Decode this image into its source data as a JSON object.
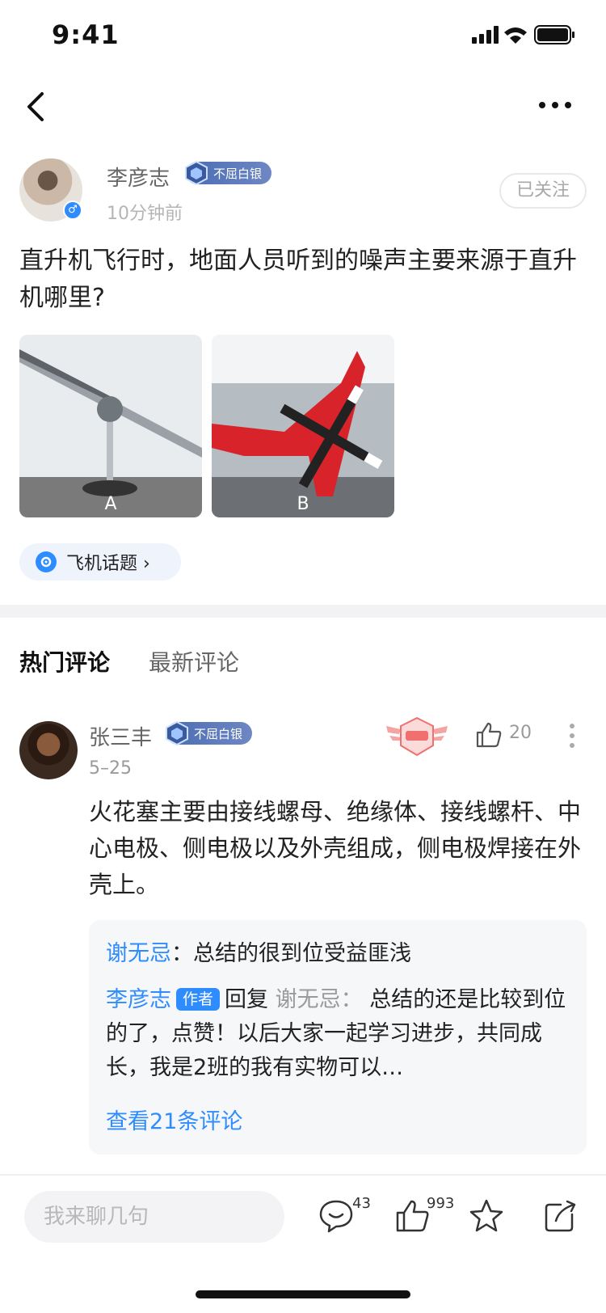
{
  "status_bar": {
    "time": "9:41"
  },
  "post": {
    "author": "李彦志",
    "badge": "不屈白银",
    "time_ago": "10分钟前",
    "follow_label": "已关注",
    "question": "直升机飞行时，地面人员听到的噪声主要来源于直升机哪里?",
    "images": [
      {
        "label": "A"
      },
      {
        "label": "B"
      }
    ],
    "topic": "飞机话题 ›"
  },
  "tabs": {
    "hot": "热门评论",
    "latest": "最新评论"
  },
  "comment": {
    "author": "张三丰",
    "badge": "不屈白银",
    "date": "5–25",
    "likes": "20",
    "text": "火花塞主要由接线螺母、绝缘体、接线螺杆、中心电极、侧电极以及外壳组成，侧电极焊接在外壳上。",
    "replies": {
      "r1_name": "谢无忌",
      "r1_sep": "：",
      "r1_text": "总结的很到位受益匪浅",
      "r2_name": "李彦志",
      "r2_tag": "作者",
      "r2_verb": "回复",
      "r2_target": "谢无忌：",
      "r2_text": "总结的还是比较到位的了，点赞！以后大家一起学习进步，共同成长，我是2班的我有实物可以…",
      "view_all": "查看21条评论"
    }
  },
  "bottom_bar": {
    "placeholder": "我来聊几句",
    "comment_count": "43",
    "like_count": "993"
  },
  "colors": {
    "accent": "#2f8cff",
    "badge": "#5a78bb",
    "stamp": "#f07070"
  }
}
